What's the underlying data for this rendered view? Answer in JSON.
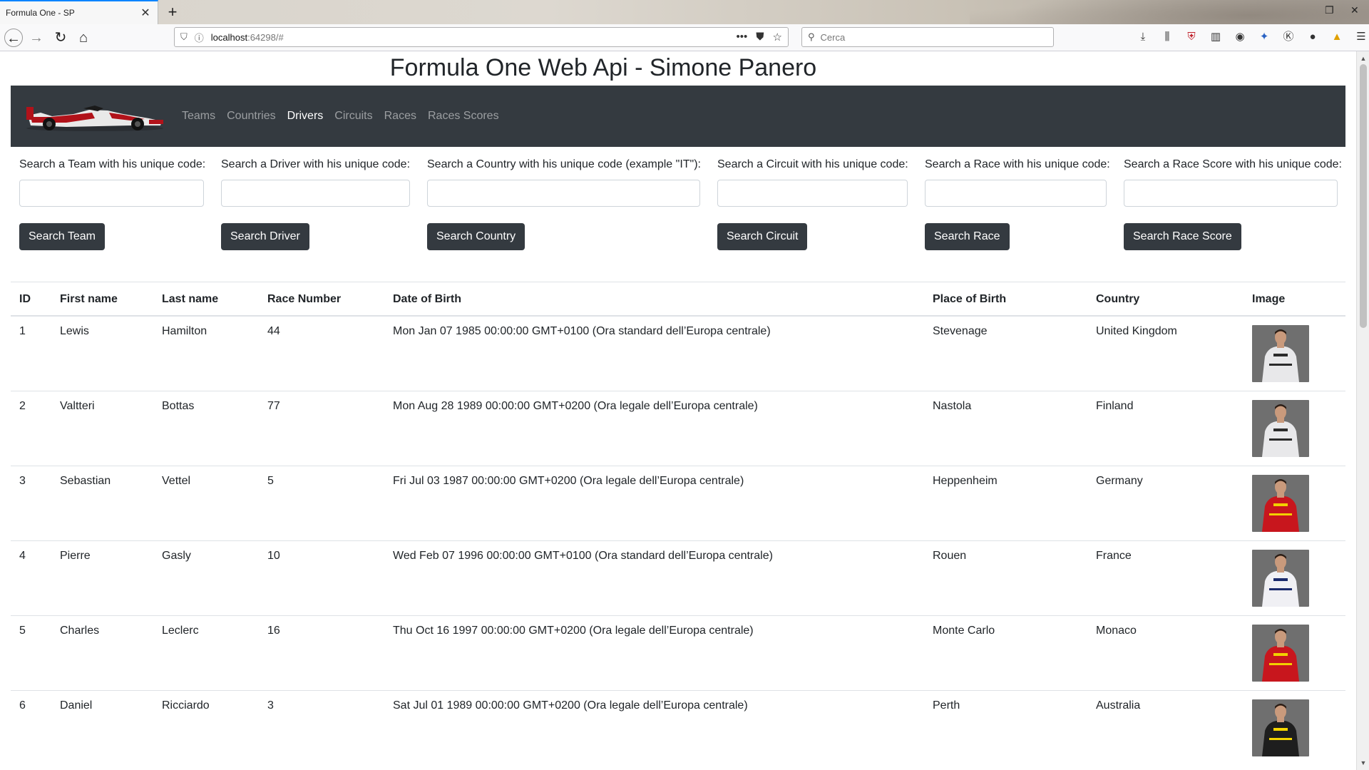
{
  "browser": {
    "tab_title": "Formula One - SP",
    "url_host": "localhost",
    "url_rest": ":64298/#",
    "search_placeholder": "Cerca"
  },
  "page": {
    "title": "Formula One Web Api - Simone Panero"
  },
  "nav": {
    "items": [
      {
        "label": "Teams",
        "active": false
      },
      {
        "label": "Countries",
        "active": false
      },
      {
        "label": "Drivers",
        "active": true
      },
      {
        "label": "Circuits",
        "active": false
      },
      {
        "label": "Races",
        "active": false
      },
      {
        "label": "Races Scores",
        "active": false
      }
    ]
  },
  "search": [
    {
      "label": "Search a Team with his unique code:",
      "button": "Search Team"
    },
    {
      "label": "Search a Driver with his unique code:",
      "button": "Search Driver"
    },
    {
      "label": "Search a Country with his unique code (example \"IT\"):",
      "button": "Search Country"
    },
    {
      "label": "Search a Circuit with his unique code:",
      "button": "Search Circuit"
    },
    {
      "label": "Search a Race with his unique code:",
      "button": "Search Race"
    },
    {
      "label": "Search a Race Score with his unique code:",
      "button": "Search Race Score"
    }
  ],
  "table": {
    "headers": [
      "ID",
      "First name",
      "Last name",
      "Race Number",
      "Date of Birth",
      "Place of Birth",
      "Country",
      "Image"
    ],
    "rows": [
      {
        "id": "1",
        "first": "Lewis",
        "last": "Hamilton",
        "number": "44",
        "dob": "Mon Jan 07 1985 00:00:00 GMT+0100 (Ora standard dell’Europa centrale)",
        "place": "Stevenage",
        "country": "United Kingdom",
        "suit_color": "#e8e8ea",
        "suit_accent": "#2b2b2b"
      },
      {
        "id": "2",
        "first": "Valtteri",
        "last": "Bottas",
        "number": "77",
        "dob": "Mon Aug 28 1989 00:00:00 GMT+0200 (Ora legale dell’Europa centrale)",
        "place": "Nastola",
        "country": "Finland",
        "suit_color": "#e8e8ea",
        "suit_accent": "#2b2b2b"
      },
      {
        "id": "3",
        "first": "Sebastian",
        "last": "Vettel",
        "number": "5",
        "dob": "Fri Jul 03 1987 00:00:00 GMT+0200 (Ora legale dell’Europa centrale)",
        "place": "Heppenheim",
        "country": "Germany",
        "suit_color": "#c8161d",
        "suit_accent": "#f2d000"
      },
      {
        "id": "4",
        "first": "Pierre",
        "last": "Gasly",
        "number": "10",
        "dob": "Wed Feb 07 1996 00:00:00 GMT+0100 (Ora standard dell’Europa centrale)",
        "place": "Rouen",
        "country": "France",
        "suit_color": "#f0f0f4",
        "suit_accent": "#1b2a6b"
      },
      {
        "id": "5",
        "first": "Charles",
        "last": "Leclerc",
        "number": "16",
        "dob": "Thu Oct 16 1997 00:00:00 GMT+0200 (Ora legale dell’Europa centrale)",
        "place": "Monte Carlo",
        "country": "Monaco",
        "suit_color": "#c8161d",
        "suit_accent": "#f2d000"
      },
      {
        "id": "6",
        "first": "Daniel",
        "last": "Ricciardo",
        "number": "3",
        "dob": "Sat Jul 01 1989 00:00:00 GMT+0200 (Ora legale dell’Europa centrale)",
        "place": "Perth",
        "country": "Australia",
        "suit_color": "#1e1e1e",
        "suit_accent": "#f5d600"
      }
    ]
  },
  "colors": {
    "navbar_bg": "#343a40",
    "button_bg": "#343a40",
    "browser_accent": "#0a84ff"
  }
}
